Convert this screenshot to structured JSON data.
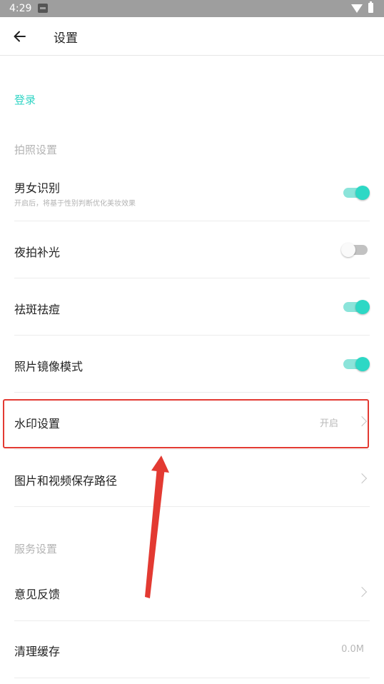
{
  "status_bar": {
    "time": "4:29"
  },
  "header": {
    "title": "设置"
  },
  "login": {
    "label": "登录"
  },
  "sections": {
    "camera": "拍照设置",
    "service": "服务设置"
  },
  "settings": {
    "gender": {
      "label": "男女识别",
      "sub": "开启后，将基于性别判断优化美妆效果",
      "on": true
    },
    "night": {
      "label": "夜拍补光",
      "on": false
    },
    "spot": {
      "label": "祛斑祛痘",
      "on": true
    },
    "mirror": {
      "label": "照片镜像模式",
      "on": true
    },
    "watermark": {
      "label": "水印设置",
      "value": "开启"
    },
    "save_path": {
      "label": "图片和视频保存路径"
    },
    "feedback": {
      "label": "意见反馈"
    },
    "cache": {
      "label": "清理缓存",
      "value": "0.0M"
    }
  },
  "colors": {
    "accent": "#2dd8c5",
    "annotation": "#e33a32"
  }
}
